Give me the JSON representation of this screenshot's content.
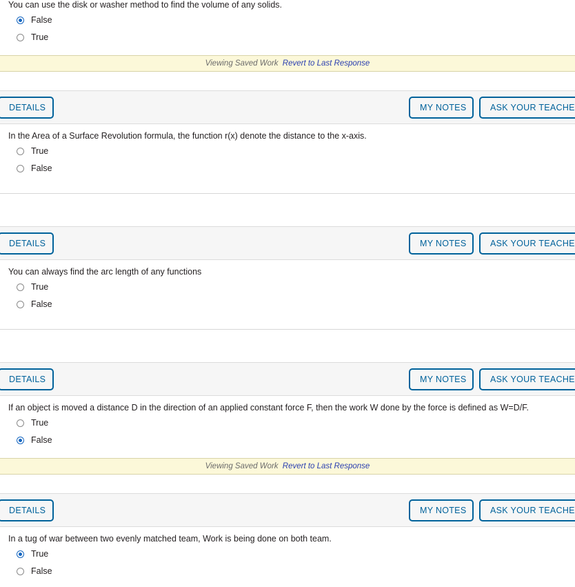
{
  "banner": {
    "saved_text": "Viewing Saved Work",
    "revert_label": "Revert to Last Response"
  },
  "toolbar": {
    "details_label": "DETAILS",
    "my_notes_label": "MY NOTES",
    "ask_your_teacher_label": "ASK YOUR TEACHER"
  },
  "colors": {
    "brand_blue": "#00629b",
    "radio_blue": "#1566c0",
    "link_blue": "#2a3fb0",
    "banner_yellow": "#fcf8d9",
    "toolbar_gray": "#f6f6f6"
  },
  "questions": [
    {
      "id": "q1",
      "text": "You can use the disk or washer method to find the volume of any solids.",
      "choices": [
        {
          "label": "False",
          "selected": true
        },
        {
          "label": "True",
          "selected": false
        }
      ],
      "saved_work_banner": true
    },
    {
      "id": "q2",
      "text": "In the Area of a Surface Revolution formula, the function r(x) denote the distance to the x-axis.",
      "choices": [
        {
          "label": "True",
          "selected": false
        },
        {
          "label": "False",
          "selected": false
        }
      ],
      "saved_work_banner": false
    },
    {
      "id": "q3",
      "text": "You can always find the arc length of any functions",
      "choices": [
        {
          "label": "True",
          "selected": false
        },
        {
          "label": "False",
          "selected": false
        }
      ],
      "saved_work_banner": false
    },
    {
      "id": "q4",
      "text": "If an object is moved a distance D in the direction of an applied constant force F, then the work W done by the force is defined as W=D/F.",
      "choices": [
        {
          "label": "True",
          "selected": false
        },
        {
          "label": "False",
          "selected": true
        }
      ],
      "saved_work_banner": true
    },
    {
      "id": "q5",
      "text": "In a tug of war between two evenly matched team, Work is being done on both team.",
      "choices": [
        {
          "label": "True",
          "selected": true
        },
        {
          "label": "False",
          "selected": false
        }
      ],
      "saved_work_banner": false
    }
  ]
}
